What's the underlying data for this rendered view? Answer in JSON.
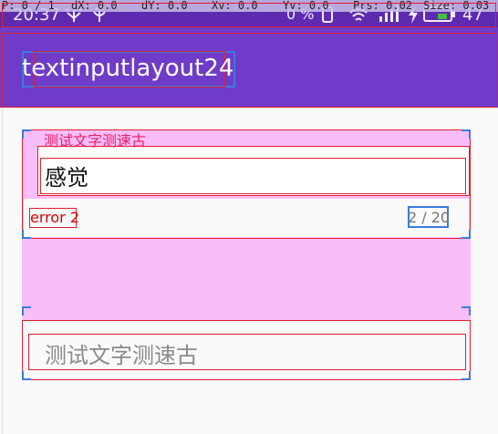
{
  "status_bar": {
    "time": "20:37",
    "battery": "47",
    "percent_label": "0 %"
  },
  "pointer_overlay": {
    "p": "P: 0 / 1",
    "dx": "dX: 0.0",
    "dy": "dY: 0.0",
    "xv": "Xv: 0.0",
    "yv": "Yv: 0.0",
    "prs": "Prs: 0.02",
    "size": "Size: 0.03"
  },
  "app_bar": {
    "title": "textinputlayout24"
  },
  "field1": {
    "label": "测试文字测速古",
    "value": "感觉",
    "error": "error 2",
    "counter": "2 / 20"
  },
  "field2": {
    "hint": "测试文字测速古"
  },
  "colors": {
    "status_bar": "#5e2bb0",
    "app_bar": "#6f3bc8",
    "accent_label": "#e91e63",
    "error": "#d50000",
    "layout_bounds_pink": "#f9bdfa"
  },
  "icons": [
    "usb-icon",
    "mic-icon",
    "vibrate-icon",
    "wifi-icon",
    "signal-icon",
    "charging-icon",
    "battery-icon"
  ]
}
